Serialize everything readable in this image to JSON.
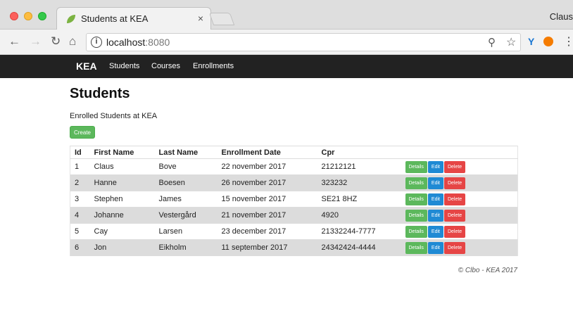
{
  "browser": {
    "tab_title": "Students at KEA",
    "tab_close": "×",
    "profile_name": "Claus",
    "url_host": "localhost",
    "url_port": ":8080",
    "icons": [
      "back-arrow-icon",
      "forward-arrow-icon",
      "reload-icon",
      "home-icon",
      "info-icon",
      "zoom-icon",
      "star-icon",
      "extension-icon",
      "menu-icon"
    ]
  },
  "navbar": {
    "brand": "KEA",
    "links": [
      "Students",
      "Courses",
      "Enrollments"
    ]
  },
  "page": {
    "title": "Students",
    "subtitle": "Enrolled Students at KEA",
    "create_label": "Create"
  },
  "table": {
    "headers": [
      "Id",
      "First Name",
      "Last Name",
      "Enrollment Date",
      "Cpr",
      ""
    ],
    "rows": [
      [
        "1",
        "Claus",
        "Bove",
        "22 november 2017",
        "21212121"
      ],
      [
        "2",
        "Hanne",
        "Boesen",
        "26 november 2017",
        "323232"
      ],
      [
        "3",
        "Stephen",
        "James",
        "15 november 2017",
        "SE21 8HZ"
      ],
      [
        "4",
        "Johanne",
        "Vestergård",
        "21 november 2017",
        "4920"
      ],
      [
        "5",
        "Cay",
        "Larsen",
        "23 december 2017",
        "21332244-7777"
      ],
      [
        "6",
        "Jon",
        "Eikholm",
        "11 september 2017",
        "24342424-4444"
      ]
    ],
    "actions": {
      "details": "Details",
      "edit": "Edit",
      "delete": "Delete"
    }
  },
  "footer": "© Clbo - KEA 2017",
  "colors": {
    "navbar": "#222222",
    "success": "#5cb85c",
    "primary": "#1f8ad4",
    "danger": "#e64545",
    "striped_row": "#dcdcdc"
  }
}
